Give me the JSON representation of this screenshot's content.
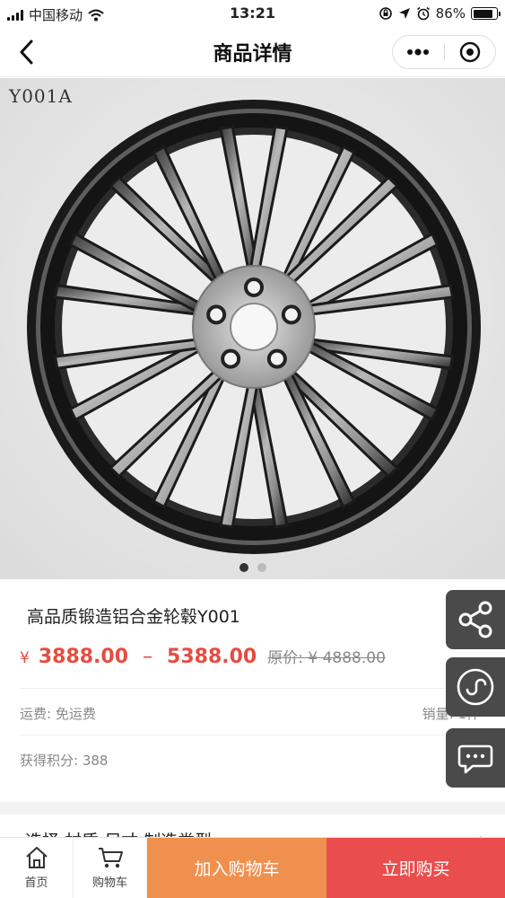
{
  "status_bar": {
    "carrier": "中国移动",
    "time": "13:21",
    "battery": "86%"
  },
  "nav": {
    "title": "商品详情"
  },
  "gallery": {
    "model_code": "Y001A",
    "slide_count": 2,
    "active_slide": 1
  },
  "product": {
    "name": "高品质锻造铝合金轮毂Y001",
    "currency": "¥",
    "price_min": "3888.00",
    "price_sep": "–",
    "price_max": "5388.00",
    "original_price": "原价: ¥ 4888.00",
    "shipping": "运费: 免运费",
    "sales": "销量: 1件",
    "points": "获得积分: 388",
    "select_spec": "选择 材质 尺寸 制造类型",
    "select_arrow": "›"
  },
  "side_actions": {
    "share": "share-icon",
    "miniprogram": "miniprogram-icon",
    "customer_service": "chat-icon"
  },
  "bottom_bar": {
    "home_label": "首页",
    "cart_label": "购物车",
    "add_to_cart_label": "加入购物车",
    "buy_now_label": "立即购买"
  },
  "colors": {
    "price_red": "#e54d42",
    "add_cart_orange": "#f0904f",
    "buy_red": "#ea4d4d",
    "float_gray": "#4a4a4a"
  }
}
